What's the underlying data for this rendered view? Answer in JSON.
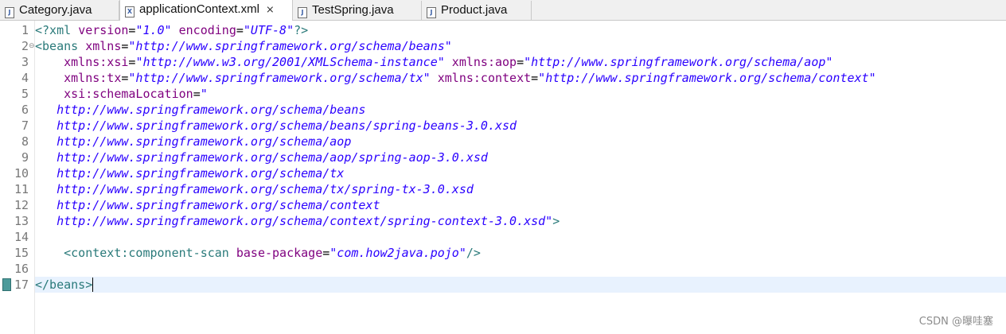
{
  "tabs": [
    {
      "label": "Category.java",
      "icon": "java-file-icon",
      "icon_glyph": "J"
    },
    {
      "label": "applicationContext.xml",
      "icon": "xml-file-icon",
      "icon_glyph": "X",
      "close": "⨯"
    },
    {
      "label": "TestSpring.java",
      "icon": "java-file-icon",
      "icon_glyph": "J"
    },
    {
      "label": "Product.java",
      "icon": "java-file-icon",
      "icon_glyph": "J"
    }
  ],
  "editor": {
    "line_numbers": [
      "1",
      "2",
      "3",
      "4",
      "5",
      "6",
      "7",
      "8",
      "9",
      "10",
      "11",
      "12",
      "13",
      "14",
      "15",
      "16",
      "17"
    ],
    "fold_marker": "⊖",
    "code": {
      "l1_open": "<?xml ",
      "l1_a1": "version",
      "l1_eq1": "=",
      "l1_v1": "\"1.0\"",
      "l1_sp": " ",
      "l1_a2": "encoding",
      "l1_eq2": "=",
      "l1_v2": "\"UTF-8\"",
      "l1_close": "?>",
      "l2_tag": "<beans",
      "l2_sp": " ",
      "l2_attr": "xmlns",
      "l2_eq": "=",
      "l2_val": "\"http://www.springframework.org/schema/beans\"",
      "l3_indent": "    ",
      "l3_attr1": "xmlns:xsi",
      "l3_eq1": "=",
      "l3_val1": "\"http://www.w3.org/2001/XMLSchema-instance\"",
      "l3_sp": " ",
      "l3_attr2": "xmlns:aop",
      "l3_eq2": "=",
      "l3_val2": "\"http://www.springframework.org/schema/aop\"",
      "l4_indent": "    ",
      "l4_attr1": "xmlns:tx",
      "l4_eq1": "=",
      "l4_val1": "\"http://www.springframework.org/schema/tx\"",
      "l4_sp": " ",
      "l4_attr2": "xmlns:context",
      "l4_eq2": "=",
      "l4_val2": "\"http://www.springframework.org/schema/context\"",
      "l5_indent": "    ",
      "l5_attr": "xsi:schemaLocation",
      "l5_eq": "=",
      "l5_val": "\"",
      "l6": "   http://www.springframework.org/schema/beans",
      "l7": "   http://www.springframework.org/schema/beans/spring-beans-3.0.xsd",
      "l8": "   http://www.springframework.org/schema/aop",
      "l9": "   http://www.springframework.org/schema/aop/spring-aop-3.0.xsd",
      "l10": "   http://www.springframework.org/schema/tx",
      "l11": "   http://www.springframework.org/schema/tx/spring-tx-3.0.xsd",
      "l12": "   http://www.springframework.org/schema/context",
      "l13_val": "   http://www.springframework.org/schema/context/spring-context-3.0.xsd\"",
      "l13_close": ">",
      "l15_indent": "    ",
      "l15_tag": "<context:component-scan",
      "l15_sp": " ",
      "l15_attr": "base-package",
      "l15_eq": "=",
      "l15_val": "\"com.how2java.pojo\"",
      "l15_close": "/>",
      "l17_tag": "</beans>"
    }
  },
  "watermark": "CSDN @曝哇塞",
  "colors": {
    "tag": "#2a7a7a",
    "attribute": "#7f007f",
    "string": "#2a00ff",
    "current_line": "#e8f2fe"
  }
}
